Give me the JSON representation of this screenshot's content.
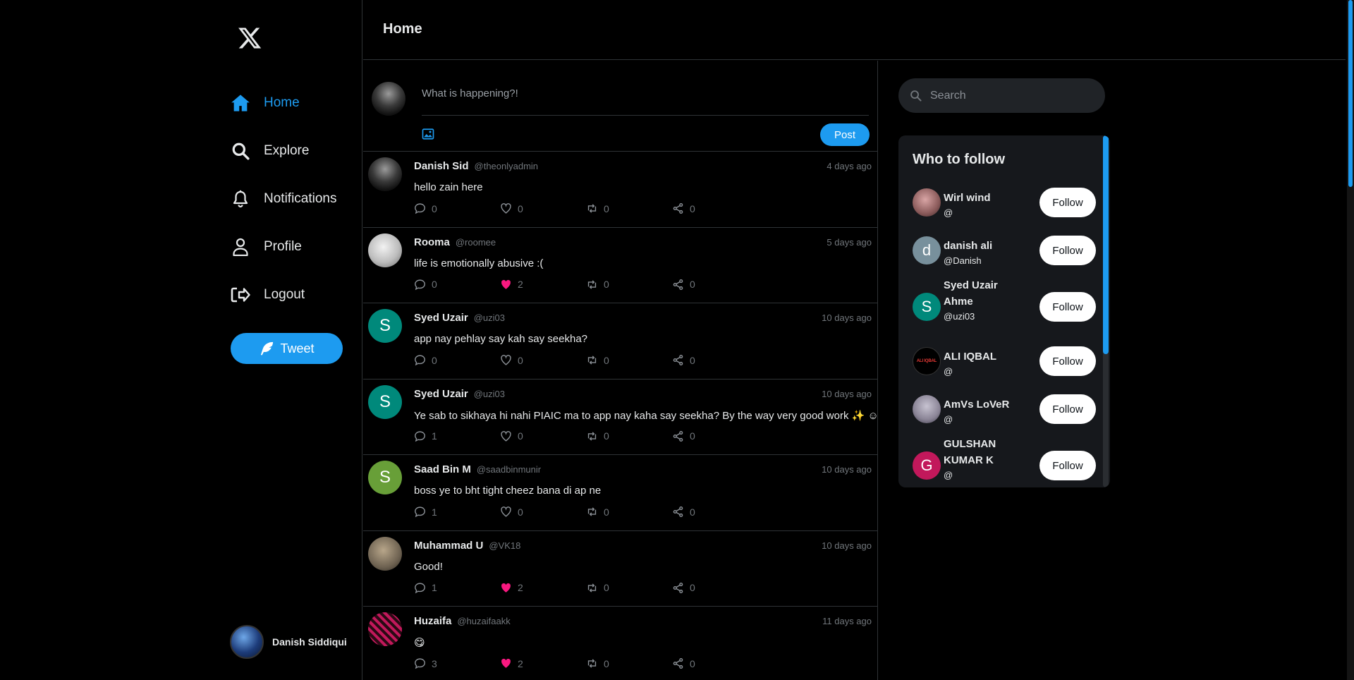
{
  "header": {
    "title": "Home"
  },
  "nav": {
    "items": [
      {
        "label": "Home",
        "icon": "home-icon",
        "active": true
      },
      {
        "label": "Explore",
        "icon": "search-icon"
      },
      {
        "label": "Notifications",
        "icon": "bell-icon"
      },
      {
        "label": "Profile",
        "icon": "user-icon"
      },
      {
        "label": "Logout",
        "icon": "logout-icon"
      }
    ],
    "tweet_label": "Tweet"
  },
  "user": {
    "name": "Danish Siddiqui"
  },
  "composer": {
    "placeholder": "What is happening?!",
    "post_label": "Post"
  },
  "posts": [
    {
      "name": "Danish Sid",
      "handle": "@theonlyadmin",
      "time": "4 days ago",
      "text": "hello zain here",
      "comments": "0",
      "likes": "0",
      "liked": false,
      "retweets": "0",
      "shares": "0"
    },
    {
      "name": "Rooma",
      "handle": "@roomee",
      "time": "5 days ago",
      "text": "life is emotionally abusive :(",
      "comments": "0",
      "likes": "2",
      "liked": true,
      "retweets": "0",
      "shares": "0"
    },
    {
      "name": "Syed Uzair",
      "handle": "@uzi03",
      "time": "10 days ago",
      "text": "app nay pehlay say kah say seekha?",
      "comments": "0",
      "likes": "0",
      "liked": false,
      "retweets": "0",
      "shares": "0",
      "initial": "S"
    },
    {
      "name": "Syed Uzair",
      "handle": "@uzi03",
      "time": "10 days ago",
      "text": "Ye sab to sikhaya hi nahi PIAIC ma to app nay kaha say seekha? By the way very good work ✨ ☺",
      "comments": "1",
      "likes": "0",
      "liked": false,
      "retweets": "0",
      "shares": "0",
      "initial": "S"
    },
    {
      "name": "Saad Bin M",
      "handle": "@saadbinmunir",
      "time": "10 days ago",
      "text": "boss ye to bht tight cheez bana di ap ne",
      "comments": "1",
      "likes": "0",
      "liked": false,
      "retweets": "0",
      "shares": "0",
      "initial": "S"
    },
    {
      "name": "Muhammad U",
      "handle": "@VK18",
      "time": "10 days ago",
      "text": "Good!",
      "comments": "1",
      "likes": "2",
      "liked": true,
      "retweets": "0",
      "shares": "0"
    },
    {
      "name": "Huzaifa",
      "handle": "@huzaifaakk",
      "time": "11 days ago",
      "text": "😋",
      "comments": "3",
      "likes": "2",
      "liked": true,
      "retweets": "0",
      "shares": "0"
    }
  ],
  "search": {
    "placeholder": "Search"
  },
  "who_to_follow": {
    "title": "Who to follow",
    "follow_label": "Follow",
    "items": [
      {
        "name": "Wirl wind",
        "handle": "@"
      },
      {
        "name": "danish ali",
        "handle": "@Danish",
        "initial": "d"
      },
      {
        "name": "Syed Uzair Ahme",
        "handle": "@uzi03",
        "initial": "S"
      },
      {
        "name": "ALI IQBAL",
        "handle": "@",
        "logo_text": "ALI IQBAL"
      },
      {
        "name": "AmVs LoVeR",
        "handle": "@"
      },
      {
        "name": "GULSHAN KUMAR K",
        "handle": "@",
        "initial": "G"
      }
    ]
  },
  "colors": {
    "accent": "#1d9bf0",
    "background": "#000000",
    "border": "#2f3336",
    "like_active": "#f91880",
    "muted_text": "#71767b"
  }
}
